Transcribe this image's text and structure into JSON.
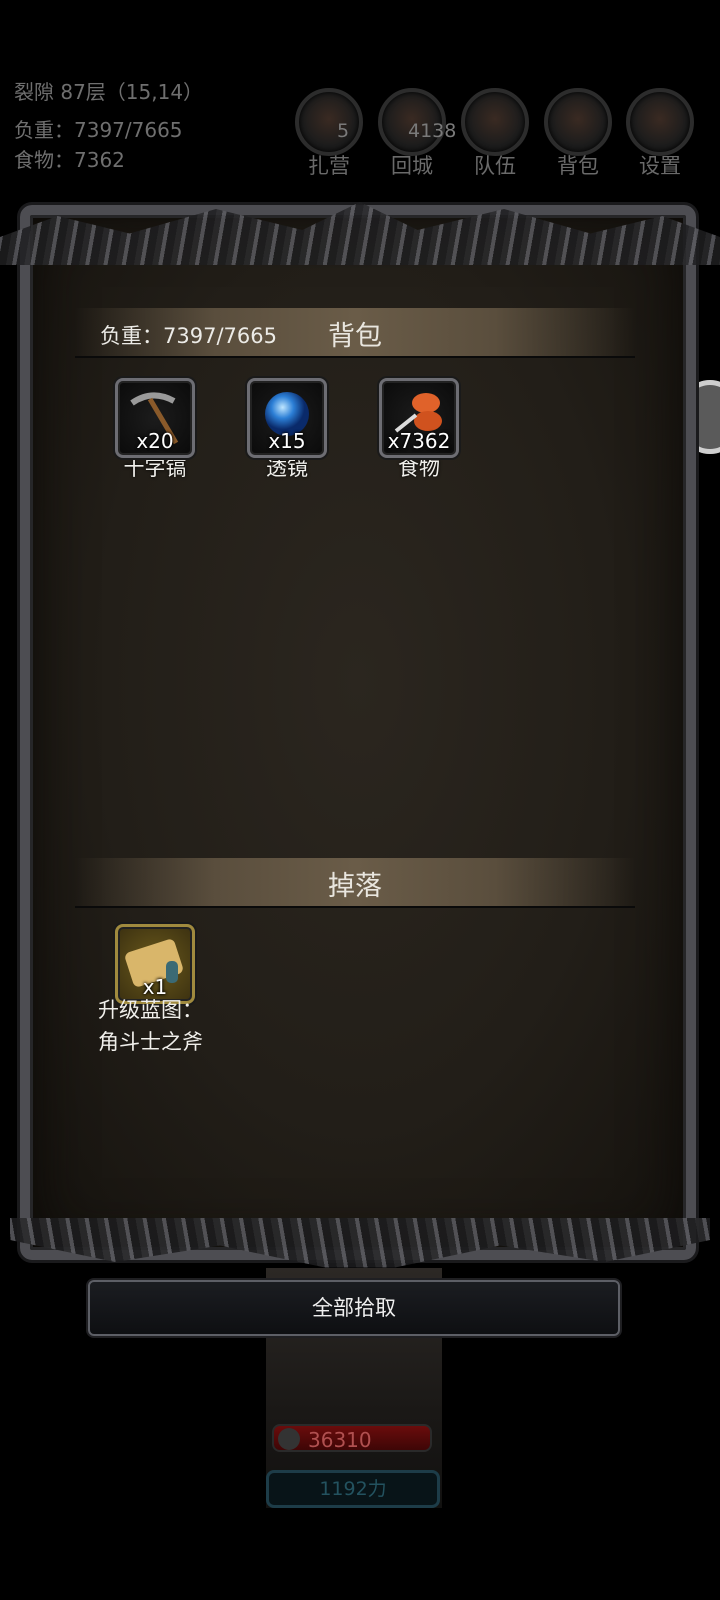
{
  "status": {
    "location": "裂隙 87层（15,14）",
    "weight": "负重：7397/7665",
    "food": "食物：7362"
  },
  "top_buttons": [
    {
      "label": "扎营",
      "badge": "5"
    },
    {
      "label": "回城",
      "badge": "4138"
    },
    {
      "label": "队伍",
      "badge": ""
    },
    {
      "label": "背包",
      "badge": ""
    },
    {
      "label": "设置",
      "badge": ""
    }
  ],
  "backpack": {
    "title": "背包",
    "weight": "负重：7397/7665",
    "items": [
      {
        "name": "十字镐",
        "qty": "x20",
        "icon": "pickaxe-icon"
      },
      {
        "name": "透镜",
        "qty": "x15",
        "icon": "lens-icon"
      },
      {
        "name": "食物",
        "qty": "x7362",
        "icon": "food-icon"
      }
    ]
  },
  "drops": {
    "title": "掉落",
    "items": [
      {
        "name_line1": "升级蓝图：",
        "name_line2": "角斗士之斧",
        "qty": "x1",
        "icon": "scroll-icon"
      }
    ]
  },
  "pickup_all": "全部拾取",
  "hero": {
    "hp": "36310",
    "power": "1192力"
  },
  "colors": {
    "panel_bg": "#221e18",
    "band": "#6a5c48",
    "hp_red": "#6a0c0c"
  }
}
